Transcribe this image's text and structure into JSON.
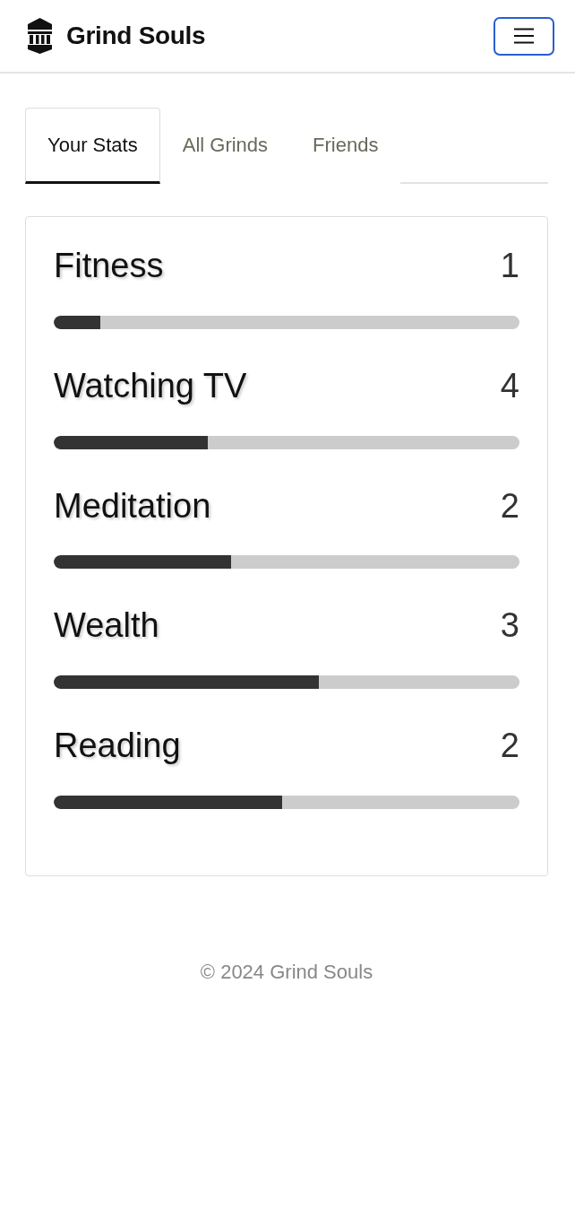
{
  "header": {
    "title": "Grind Souls"
  },
  "tabs": [
    {
      "label": "Your Stats",
      "selected": true
    },
    {
      "label": "All Grinds",
      "selected": false
    },
    {
      "label": "Friends",
      "selected": false
    }
  ],
  "stats": [
    {
      "name": "Fitness",
      "value": "1",
      "level": 0.1
    },
    {
      "name": "Watching TV",
      "value": "4",
      "level": 0.33
    },
    {
      "name": "Meditation",
      "value": "2",
      "level": 0.38
    },
    {
      "name": "Wealth",
      "value": "3",
      "level": 0.57
    },
    {
      "name": "Reading",
      "value": "2",
      "level": 0.49
    }
  ],
  "footer": {
    "text": "© 2024 Grind Souls"
  }
}
